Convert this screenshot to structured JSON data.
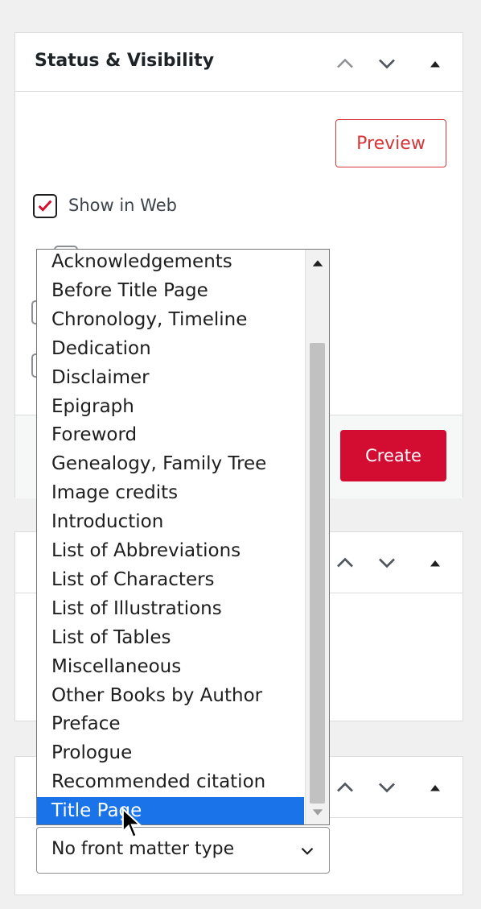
{
  "status_panel": {
    "title": "Status & Visibility",
    "preview_label": "Preview",
    "show_in_web_label": "Show in Web",
    "show_in_web_checked": true,
    "create_label": "Create"
  },
  "colors": {
    "accent_red": "#d30c32",
    "preview_red": "#d63638",
    "selection_blue": "#1a73e8"
  },
  "front_matter_dropdown": {
    "options": [
      "Acknowledgements",
      "Before Title Page",
      "Chronology, Timeline",
      "Dedication",
      "Disclaimer",
      "Epigraph",
      "Foreword",
      "Genealogy, Family Tree",
      "Image credits",
      "Introduction",
      "List of Abbreviations",
      "List of Characters",
      "List of Illustrations",
      "List of Tables",
      "Miscellaneous",
      "Other Books by Author",
      "Preface",
      "Prologue",
      "Recommended citation",
      "Title Page"
    ],
    "highlighted": "Title Page",
    "selected_value": "No front matter type"
  },
  "icons": {
    "move_up": "chevron-up-icon",
    "move_down": "chevron-down-icon",
    "collapse": "triangle-up-icon",
    "checkmark": "checkmark-icon",
    "cursor": "mouse-pointer-icon"
  }
}
